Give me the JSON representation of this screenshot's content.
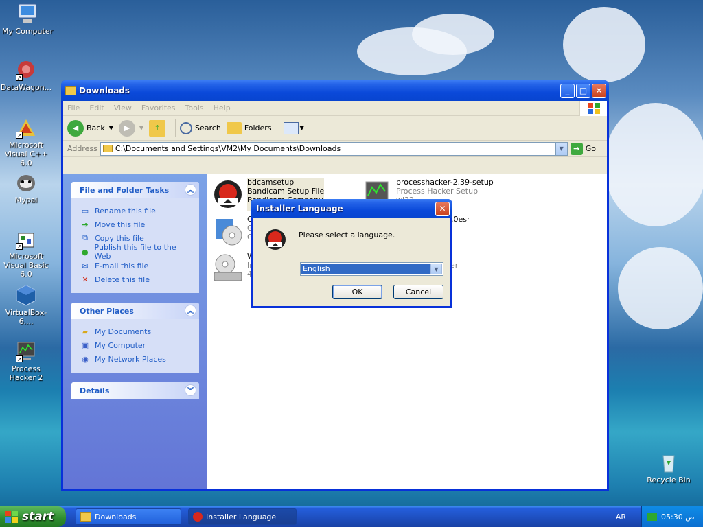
{
  "desktop": {
    "icons": [
      {
        "label": "My Computer",
        "icon": "my-computer-icon"
      },
      {
        "label": "DataWagon...",
        "icon": "datawagon-icon"
      },
      {
        "label": "Microsoft Visual C++ 6.0",
        "icon": "visual-cpp-icon"
      },
      {
        "label": "Mypal",
        "icon": "mypal-icon"
      },
      {
        "label": "Microsoft Visual Basic 6.0",
        "icon": "visual-basic-icon"
      },
      {
        "label": "VirtualBox-6....",
        "icon": "virtualbox-icon"
      },
      {
        "label": "Process Hacker 2",
        "icon": "process-hacker-icon"
      },
      {
        "label": "Recycle Bin",
        "icon": "recycle-bin-icon"
      }
    ]
  },
  "explorer": {
    "title": "Downloads",
    "menu": [
      "File",
      "Edit",
      "View",
      "Favorites",
      "Tools",
      "Help"
    ],
    "toolbar": {
      "back": "Back",
      "search": "Search",
      "folders": "Folders"
    },
    "address": {
      "label": "Address",
      "value": "C:\\Documents and Settings\\VM2\\My Documents\\Downloads",
      "go": "Go"
    },
    "tasks_panel": {
      "title": "File and Folder Tasks",
      "items": [
        "Rename this file",
        "Move this file",
        "Copy this file",
        "Publish this file to the Web",
        "E-mail this file",
        "Delete this file"
      ]
    },
    "places_panel": {
      "title": "Other Places",
      "items": [
        "My Documents",
        "My Computer",
        "My Network Places"
      ]
    },
    "details_panel": {
      "title": "Details"
    },
    "files": [
      {
        "name": "bdcamsetup",
        "line2": "Bandicam Setup File",
        "line3": "Bandicam Company"
      },
      {
        "name": "processhacker-2.39-setup",
        "line2": "Process Hacker Setup",
        "line3": "wj32"
      },
      {
        "name": "C",
        "line2": "G",
        "line3": "G",
        "tail": "9.0esr"
      },
      {
        "name": "W",
        "line2": "In",
        "line3": "4",
        "tail": "er"
      }
    ]
  },
  "dialog": {
    "title": "Installer Language",
    "message": "Please select a language.",
    "selected": "English",
    "ok": "OK",
    "cancel": "Cancel"
  },
  "taskbar": {
    "start": "start",
    "buttons": [
      "Downloads",
      "Installer Language"
    ],
    "lang": "AR",
    "time": "05:30 ص"
  },
  "colors": {
    "xp_blue": "#0831d9",
    "task_link": "#215dc6",
    "selection": "#316ac5"
  }
}
